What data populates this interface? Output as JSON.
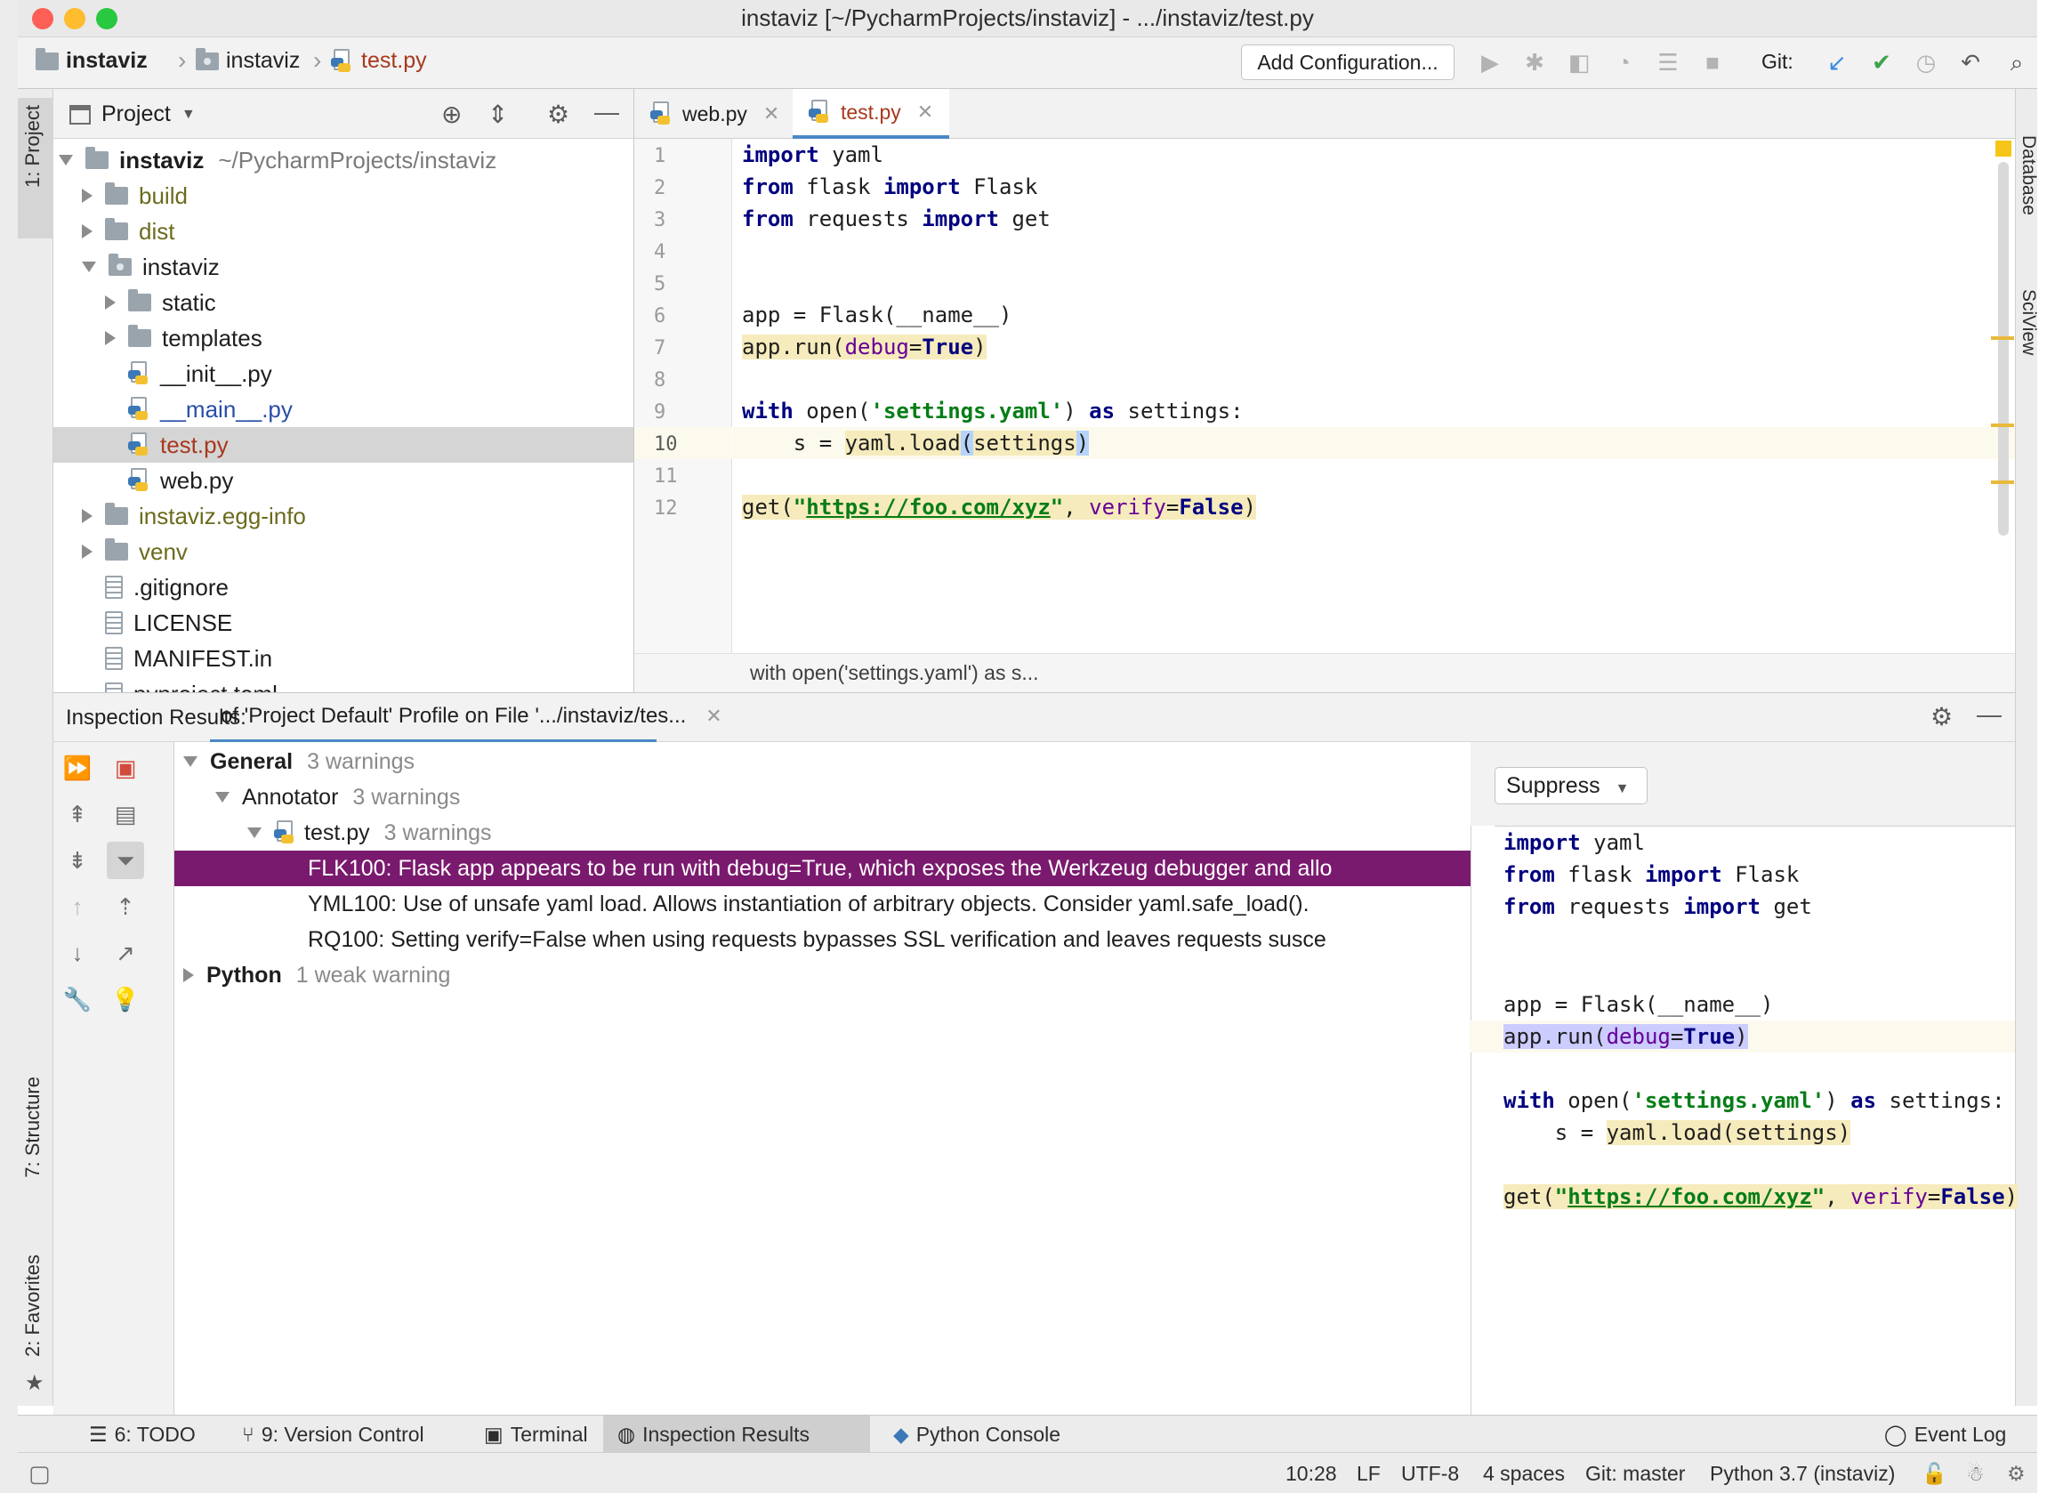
{
  "window": {
    "title": "instaviz [~/PycharmProjects/instaviz] - .../instaviz/test.py",
    "traffic_colors": [
      "#fd5f57",
      "#febc2e",
      "#28c840"
    ]
  },
  "nav": {
    "breadcrumbs": [
      "instaviz",
      "instaviz",
      "test.py"
    ],
    "add_config_label": "Add Configuration...",
    "git_label": "Git:"
  },
  "left_tool_tabs": {
    "project": "1: Project",
    "structure": "7: Structure",
    "favorites": "2: Favorites"
  },
  "right_tool_tabs": {
    "database": "Database",
    "sciview": "SciView"
  },
  "project_panel": {
    "title": "Project",
    "root_name": "instaviz",
    "root_path": "~/PycharmProjects/instaviz",
    "items": [
      {
        "label": "build",
        "kind": "folder",
        "color": "#6b6b1e"
      },
      {
        "label": "dist",
        "kind": "folder",
        "color": "#6b6b1e"
      },
      {
        "label": "instaviz",
        "kind": "package",
        "color": "#1e1e1e"
      },
      {
        "label": "static",
        "kind": "folder",
        "color": "#1e1e1e"
      },
      {
        "label": "templates",
        "kind": "folder",
        "color": "#1e1e1e"
      },
      {
        "label": "__init__.py",
        "kind": "py",
        "color": "#1e1e1e"
      },
      {
        "label": "__main__.py",
        "kind": "py",
        "color": "#2a4ea8"
      },
      {
        "label": "test.py",
        "kind": "py",
        "color": "#a8381e"
      },
      {
        "label": "web.py",
        "kind": "py",
        "color": "#1e1e1e"
      },
      {
        "label": "instaviz.egg-info",
        "kind": "folder",
        "color": "#6b6b1e"
      },
      {
        "label": "venv",
        "kind": "folder",
        "color": "#6b6b1e"
      },
      {
        "label": ".gitignore",
        "kind": "text",
        "color": "#1e1e1e"
      },
      {
        "label": "LICENSE",
        "kind": "text",
        "color": "#1e1e1e"
      },
      {
        "label": "MANIFEST.in",
        "kind": "text",
        "color": "#1e1e1e"
      },
      {
        "label": "pyproject.toml",
        "kind": "text",
        "color": "#1e1e1e"
      }
    ]
  },
  "editor": {
    "tabs": [
      {
        "label": "web.py",
        "active": false
      },
      {
        "label": "test.py",
        "active": true
      }
    ],
    "line_numbers": [
      "1",
      "2",
      "3",
      "4",
      "5",
      "6",
      "7",
      "8",
      "9",
      "10",
      "11",
      "12"
    ],
    "code": {
      "l1_kw": "import",
      "l1_rest": " yaml",
      "l2_kw1": "from",
      "l2_mid": " flask ",
      "l2_kw2": "import",
      "l2_rest": " Flask",
      "l3_kw1": "from",
      "l3_mid": " requests ",
      "l3_kw2": "import",
      "l3_rest": " get",
      "l6": "app = Flask(__name__)",
      "l7_a": "app.run(",
      "l7_kwarg": "debug",
      "l7_eq": "=",
      "l7_bool": "True",
      "l7_close": ")",
      "l9_kw": "with",
      "l9_a": " open(",
      "l9_str": "'settings.yaml'",
      "l9_b": ") ",
      "l9_kw2": "as",
      "l9_c": " settings:",
      "l10_indent": "    s = ",
      "l10_a": "yaml.load",
      "l10_paren": "(",
      "l10_b": "settings",
      "l10_close": ")",
      "l12_a": "get(",
      "l12_q1": "\"",
      "l12_url": "https://foo.com/xyz",
      "l12_q2": "\"",
      "l12_b": ", ",
      "l12_kwarg": "verify",
      "l12_eq": "=",
      "l12_bool": "False",
      "l12_close": ")"
    },
    "breadcrumb": "with open('settings.yaml') as s..."
  },
  "inspection": {
    "label": "Inspection Results:",
    "tab_label": "of 'Project Default' Profile on File '.../instaviz/tes...",
    "general": {
      "label": "General",
      "count": "3 warnings"
    },
    "annotator": {
      "label": "Annotator",
      "count": "3 warnings"
    },
    "file": {
      "label": "test.py",
      "count": "3 warnings"
    },
    "problems": [
      "FLK100: Flask app appears to be run with debug=True, which exposes the Werkzeug debugger and allo",
      "YML100: Use of unsafe yaml load. Allows instantiation of arbitrary objects. Consider yaml.safe_load().",
      "RQ100: Setting verify=False when using requests bypasses SSL verification and leaves requests susce"
    ],
    "python": {
      "label": "Python",
      "count": "1 weak warning"
    },
    "suppress_label": "Suppress"
  },
  "bottom_tools": {
    "todo": "6: TODO",
    "vcs": "9: Version Control",
    "terminal": "Terminal",
    "inspection": "Inspection Results",
    "console": "Python Console",
    "event_log": "Event Log"
  },
  "status": {
    "position": "10:28",
    "line_sep": "LF",
    "encoding": "UTF-8",
    "indent": "4 spaces",
    "git_branch": "Git: master",
    "interpreter": "Python 3.7 (instaviz)"
  },
  "colors": {
    "selection_purple": "#7a1a6e",
    "accent_blue": "#4a88c7",
    "warning_yellow": "#f6ebbc"
  }
}
